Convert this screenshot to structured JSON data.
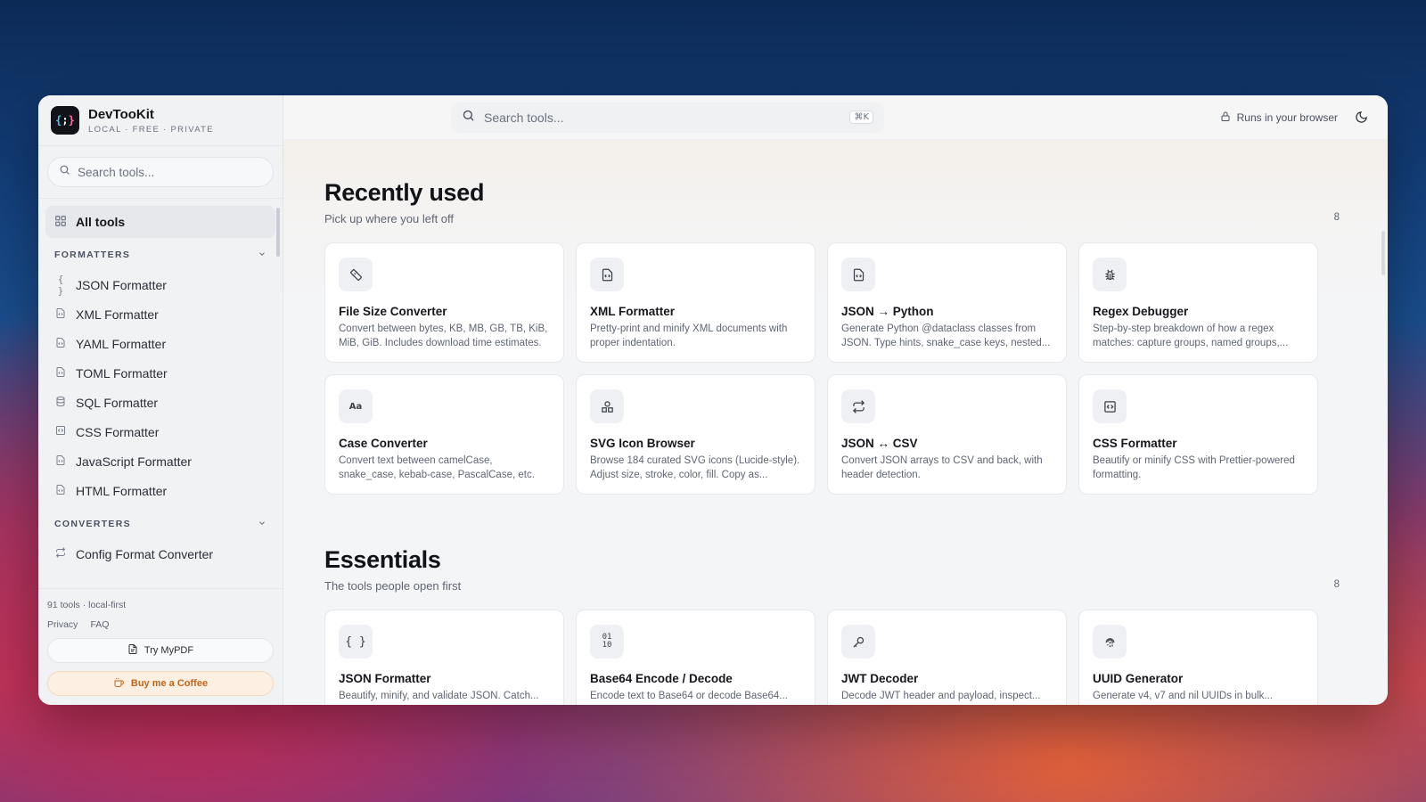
{
  "brand": {
    "name": "DevTooKit",
    "tagline": "LOCAL · FREE · PRIVATE",
    "logo_text": "{;}"
  },
  "sidebar": {
    "search_placeholder": "Search tools...",
    "all_tools_label": "All tools",
    "sections": [
      {
        "label": "FORMATTERS",
        "items": [
          {
            "label": "JSON Formatter",
            "icon": "braces-icon"
          },
          {
            "label": "XML Formatter",
            "icon": "file-code-icon"
          },
          {
            "label": "YAML Formatter",
            "icon": "file-code-icon"
          },
          {
            "label": "TOML Formatter",
            "icon": "file-code-icon"
          },
          {
            "label": "SQL Formatter",
            "icon": "database-icon"
          },
          {
            "label": "CSS Formatter",
            "icon": "code-square-icon"
          },
          {
            "label": "JavaScript Formatter",
            "icon": "file-code-icon"
          },
          {
            "label": "HTML Formatter",
            "icon": "file-code-icon"
          }
        ]
      },
      {
        "label": "CONVERTERS",
        "items": [
          {
            "label": "Config Format Converter",
            "icon": "repeat-icon"
          }
        ]
      }
    ],
    "footer": {
      "meta": "91 tools · local-first",
      "privacy": "Privacy",
      "faq": "FAQ",
      "try_mypdf": "Try MyPDF",
      "coffee": "Buy me a Coffee"
    }
  },
  "topbar": {
    "search_placeholder": "Search tools...",
    "shortcut": "⌘K",
    "runs_label": "Runs in your browser"
  },
  "recent": {
    "title": "Recently used",
    "subtitle": "Pick up where you left off",
    "count": "8",
    "cards": [
      {
        "title": "File Size Converter",
        "desc": "Convert between bytes, KB, MB, GB, TB, KiB, MiB, GiB. Includes download time estimates.",
        "icon": "ruler-icon"
      },
      {
        "title": "XML Formatter",
        "desc": "Pretty-print and minify XML documents with proper indentation.",
        "icon": "file-code-icon"
      },
      {
        "title": "JSON → Python",
        "desc": "Generate Python @dataclass classes from JSON. Type hints, snake_case keys, nested...",
        "icon": "file-code-icon"
      },
      {
        "title": "Regex Debugger",
        "desc": "Step-by-step breakdown of how a regex matches: capture groups, named groups,...",
        "icon": "bug-icon"
      },
      {
        "title": "Case Converter",
        "desc": "Convert text between camelCase, snake_case, kebab-case, PascalCase, etc.",
        "icon": "case-icon"
      },
      {
        "title": "SVG Icon Browser",
        "desc": "Browse 184 curated SVG icons (Lucide-style). Adjust size, stroke, color, fill. Copy as...",
        "icon": "shapes-icon"
      },
      {
        "title": "JSON ↔ CSV",
        "desc": "Convert JSON arrays to CSV and back, with header detection.",
        "icon": "repeat-icon"
      },
      {
        "title": "CSS Formatter",
        "desc": "Beautify or minify CSS with Prettier-powered formatting.",
        "icon": "code-square-icon"
      }
    ]
  },
  "essentials": {
    "title": "Essentials",
    "subtitle": "The tools people open first",
    "count": "8",
    "cards": [
      {
        "title": "JSON Formatter",
        "desc": "Beautify, minify, and validate JSON. Catch...",
        "icon": "braces-icon"
      },
      {
        "title": "Base64 Encode / Decode",
        "desc": "Encode text to Base64 or decode Base64...",
        "icon": "binary-icon"
      },
      {
        "title": "JWT Decoder",
        "desc": "Decode JWT header and payload, inspect...",
        "icon": "key-icon"
      },
      {
        "title": "UUID Generator",
        "desc": "Generate v4, v7 and nil UUIDs in bulk...",
        "icon": "fingerprint-icon"
      }
    ]
  }
}
